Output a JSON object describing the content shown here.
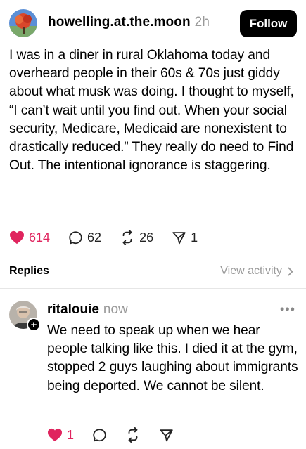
{
  "post": {
    "username": "howelling.at.the.moon",
    "time": "2h",
    "follow_label": "Follow",
    "text": "I was in a diner in rural Oklahoma today and overheard people in their 60s & 70s just giddy about what musk was doing. I thought to myself, “I can’t wait until you find out. When your social security, Medicare, Medicaid are nonexistent to drastically reduced.” They really do need to Find Out. The intentional ignorance is staggering.",
    "likes": "614",
    "comments": "62",
    "reposts": "26",
    "shares": "1",
    "liked": true
  },
  "replies_section": {
    "label": "Replies",
    "view_activity": "View activity"
  },
  "reply": {
    "username": "ritalouie",
    "time": "now",
    "more": "•••",
    "plus": "+",
    "text": "We need to speak up when we hear people talking like this.  I died it at the gym, stopped 2 guys laughing about immigrants being deported. We cannot be silent.",
    "likes": "1",
    "liked": true
  },
  "colors": {
    "like": "#e0245e",
    "muted": "#9a9a9a",
    "divider": "#e6e6e6",
    "button_bg": "#000000"
  },
  "icons": {
    "like": "heart-icon",
    "comment": "comment-bubble-icon",
    "repost": "repost-icon",
    "share": "send-icon",
    "chevron": "chevron-right-icon",
    "more": "more-dots-icon"
  }
}
